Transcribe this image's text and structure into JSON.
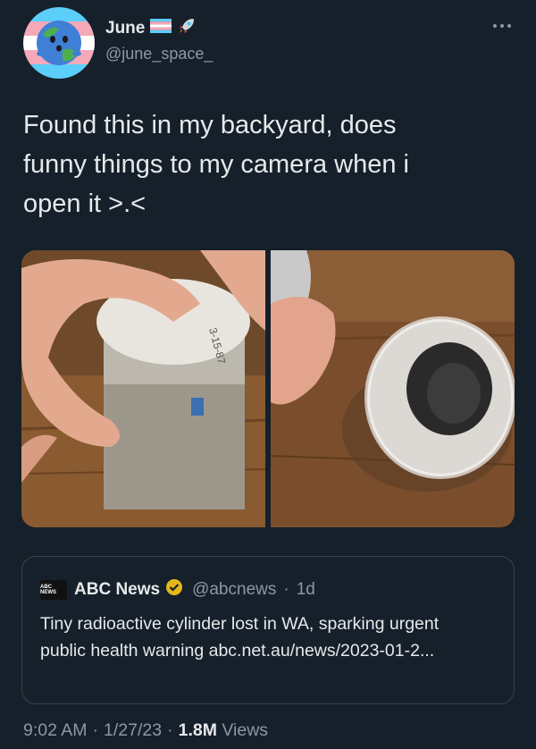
{
  "author": {
    "display_name": "June",
    "handle": "@june_space_",
    "avatar_icon": "earth-character-avatar",
    "name_badges": [
      "transgender-flag-icon",
      "rocket-icon"
    ]
  },
  "tweet": {
    "text": "Found this in my backyard, does\nfunny things to my camera when i\nopen it >.<"
  },
  "media": [
    {
      "name": "photo-closed-cylinder",
      "description_icon": "cylinder-closed"
    },
    {
      "name": "photo-open-cylinder",
      "description_icon": "cylinder-open"
    }
  ],
  "quote": {
    "logo_text": "ABC NEWS",
    "name": "ABC News",
    "verified_icon": "verified-gold-badge-icon",
    "handle": "@abcnews",
    "separator": "·",
    "time": "1d",
    "text": "Tiny radioactive cylinder lost in WA, sparking urgent public health warning abc.net.au/news/2023-01-2..."
  },
  "meta": {
    "time": "9:02 AM",
    "sep1": "·",
    "date": "1/27/23",
    "sep2": "·",
    "views_count": "1.8M",
    "views_label": "Views"
  },
  "colors": {
    "background": "#15202b",
    "primary_text": "#e7e9ea",
    "secondary_text": "#8b98a5",
    "border": "#38444d",
    "verified_gold": "#e2b719"
  }
}
